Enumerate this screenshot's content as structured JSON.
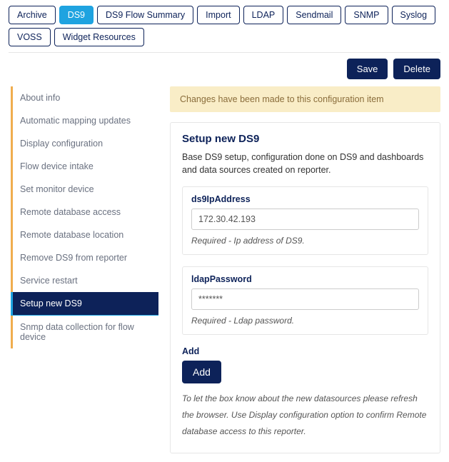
{
  "tabs": [
    {
      "label": "Archive",
      "active": false
    },
    {
      "label": "DS9",
      "active": true
    },
    {
      "label": "DS9 Flow Summary",
      "active": false
    },
    {
      "label": "Import",
      "active": false
    },
    {
      "label": "LDAP",
      "active": false
    },
    {
      "label": "Sendmail",
      "active": false
    },
    {
      "label": "SNMP",
      "active": false
    },
    {
      "label": "Syslog",
      "active": false
    },
    {
      "label": "VOSS",
      "active": false
    },
    {
      "label": "Widget Resources",
      "active": false
    }
  ],
  "actions": {
    "save": "Save",
    "delete": "Delete"
  },
  "sidebar": {
    "items": [
      {
        "label": "About info",
        "active": false
      },
      {
        "label": "Automatic mapping updates",
        "active": false
      },
      {
        "label": "Display configuration",
        "active": false
      },
      {
        "label": "Flow device intake",
        "active": false
      },
      {
        "label": "Set monitor device",
        "active": false
      },
      {
        "label": "Remote database access",
        "active": false
      },
      {
        "label": "Remote database location",
        "active": false
      },
      {
        "label": "Remove DS9 from reporter",
        "active": false
      },
      {
        "label": "Service restart",
        "active": false
      },
      {
        "label": "Setup new DS9",
        "active": true
      },
      {
        "label": "Snmp data collection for flow device",
        "active": false
      }
    ]
  },
  "alert": "Changes have been made to this configuration item",
  "panel": {
    "title": "Setup new DS9",
    "description": "Base DS9 setup, configuration done on DS9 and dashboards and data sources created on reporter.",
    "fields": [
      {
        "label": "ds9IpAddress",
        "value": "172.30.42.193",
        "help": "Required - Ip address of DS9."
      },
      {
        "label": "ldapPassword",
        "value": "*******",
        "help": "Required - Ldap password."
      }
    ],
    "add": {
      "label": "Add",
      "button": "Add",
      "help": "To let the box know about the new datasources please refresh the browser. Use Display configuration option to confirm Remote database access to this reporter."
    }
  }
}
